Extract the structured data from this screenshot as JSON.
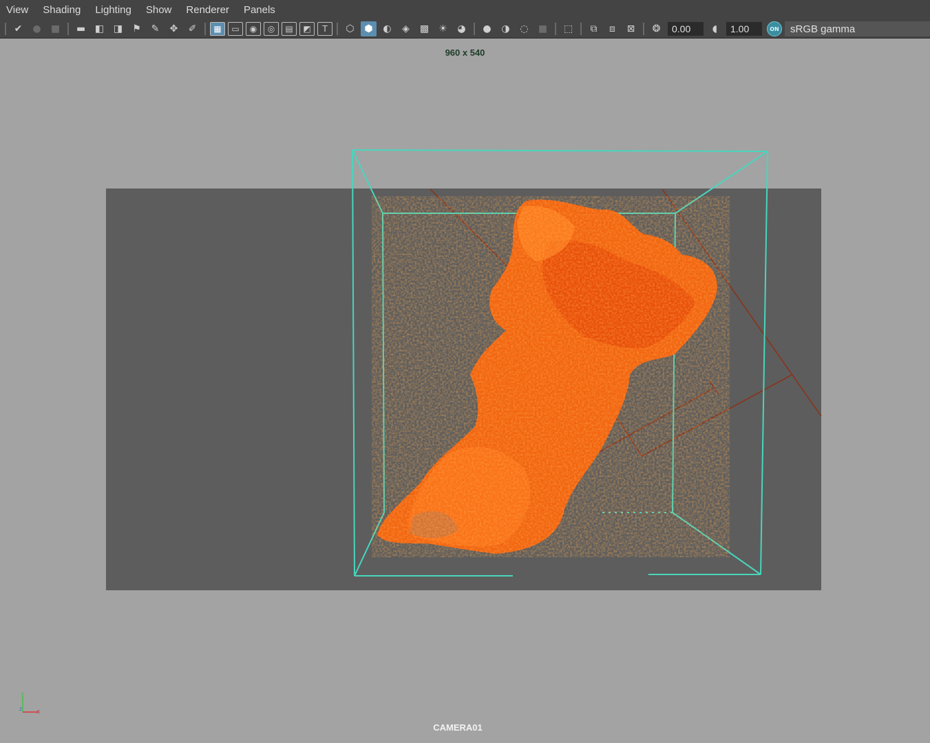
{
  "menu": [
    "View",
    "Shading",
    "Lighting",
    "Show",
    "Renderer",
    "Panels"
  ],
  "toolbar": {
    "exposure_value": "0.00",
    "gamma_value": "1.00",
    "color_management_toggle": "ON",
    "color_space": "sRGB gamma",
    "icons": [
      "select-camera-icon",
      "camera-attributes-icon",
      "bookmark-icon",
      "image-plane-icon",
      "camera-icon",
      "camera-lock-icon",
      "camera-track-icon",
      "bookmark-flag-icon",
      "grease-pencil-icon",
      "2d-pan-zoom-icon",
      "paint-icon",
      "grid-icon",
      "film-gate-icon",
      "resolution-gate-icon",
      "gate-mask-icon",
      "field-chart-icon",
      "safe-action-icon",
      "safe-title-icon",
      "wireframe-icon",
      "smooth-shade-icon",
      "wireframe-on-shaded-icon",
      "default-material-icon",
      "textured-icon",
      "use-all-lights-icon",
      "shadows-icon",
      "screen-space-ao-icon",
      "motion-blur-icon",
      "anti-aliasing-icon",
      "depth-of-field-icon",
      "isolate-select-icon",
      "xray-icon",
      "xray-active-components-icon",
      "xray-joints-icon",
      "exposure-icon",
      "gamma-icon",
      "color-management-icon"
    ]
  },
  "viewport": {
    "resolution": "960 x 540",
    "camera": "CAMERA01",
    "axis_labels": {
      "y": "y",
      "z": "z",
      "x": "x"
    },
    "colors": {
      "background": "#a3a3a3",
      "render_region": "#5d5d5d",
      "bounding_box": "#48d6bd",
      "fluid": "#ff6a10",
      "emitter_lines": "#8a3218"
    }
  }
}
